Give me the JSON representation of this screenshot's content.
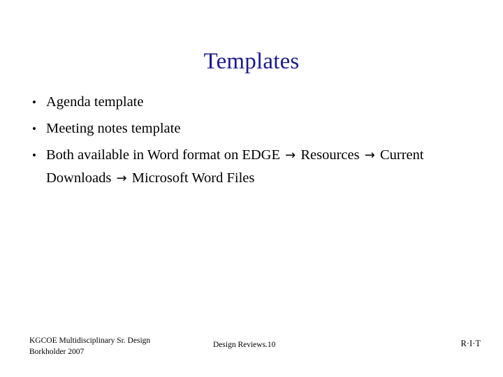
{
  "slide": {
    "title": "Templates",
    "title_color": "#1b1b8f",
    "background_color": "#ffffff",
    "body_text_color": "#000000"
  },
  "bullets": [
    {
      "marker": "•",
      "segments": [
        {
          "type": "text",
          "value": "Agenda template"
        }
      ]
    },
    {
      "marker": "•",
      "segments": [
        {
          "type": "text",
          "value": "Meeting notes template"
        }
      ]
    },
    {
      "marker": "•",
      "segments": [
        {
          "type": "text",
          "value": "Both available in Word format on EDGE "
        },
        {
          "type": "arrow",
          "value": "→"
        },
        {
          "type": "text",
          "value": " Resources "
        },
        {
          "type": "arrow",
          "value": "→"
        },
        {
          "type": "text",
          "value": " Current Downloads "
        },
        {
          "type": "arrow",
          "value": "→"
        },
        {
          "type": "text",
          "value": " Microsoft Word Files"
        }
      ]
    }
  ],
  "footer": {
    "left_line1": "KGCOE Multidisciplinary Sr. Design",
    "left_line2": "Borkholder 2007",
    "center": "Design Reviews.10",
    "right": "R·I·T"
  }
}
